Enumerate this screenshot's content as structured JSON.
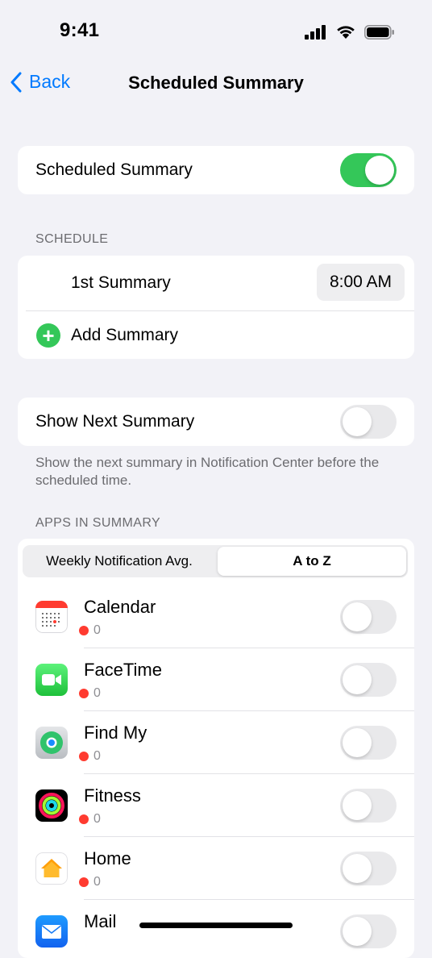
{
  "status_bar": {
    "time": "9:41"
  },
  "nav": {
    "back_label": "Back",
    "title": "Scheduled Summary"
  },
  "scheduled_summary": {
    "label": "Scheduled Summary",
    "enabled": true
  },
  "schedule": {
    "header": "SCHEDULE",
    "first_summary_label": "1st Summary",
    "first_summary_time": "8:00 AM",
    "add_summary_label": "Add Summary"
  },
  "show_next": {
    "label": "Show Next Summary",
    "enabled": false,
    "footnote": "Show the next summary in Notification Center before the scheduled time."
  },
  "apps_in_summary": {
    "header": "APPS IN SUMMARY",
    "sort_options": [
      "Weekly Notification Avg.",
      "A to Z"
    ],
    "selected_sort": "A to Z",
    "apps": [
      {
        "name": "Calendar",
        "count": "0",
        "icon": "calendar-app-icon",
        "enabled": false
      },
      {
        "name": "FaceTime",
        "count": "0",
        "icon": "facetime-app-icon",
        "enabled": false
      },
      {
        "name": "Find My",
        "count": "0",
        "icon": "findmy-app-icon",
        "enabled": false
      },
      {
        "name": "Fitness",
        "count": "0",
        "icon": "fitness-app-icon",
        "enabled": false
      },
      {
        "name": "Home",
        "count": "0",
        "icon": "home-app-icon",
        "enabled": false
      },
      {
        "name": "Mail",
        "count": "",
        "icon": "mail-app-icon",
        "enabled": false
      }
    ]
  },
  "colors": {
    "accent": "#007aff",
    "toggle_on": "#34c759",
    "dot": "#ff3b30",
    "background": "#f2f2f7"
  }
}
